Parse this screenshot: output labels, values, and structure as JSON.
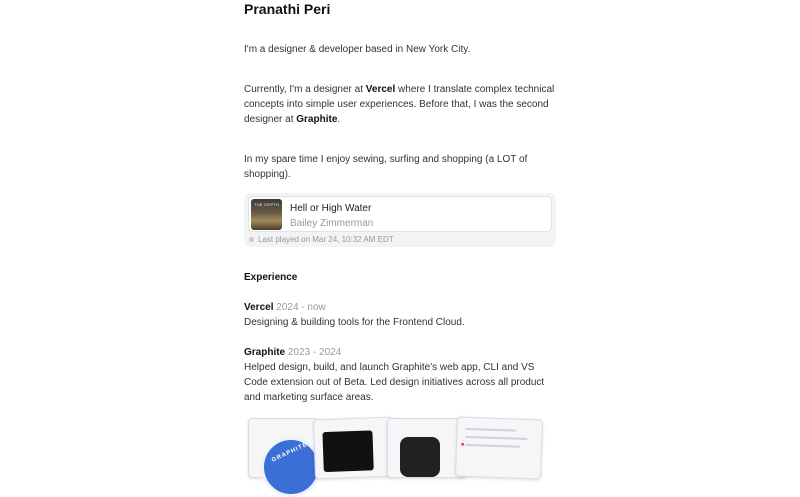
{
  "profile": {
    "name": "Pranathi Peri",
    "intro": "I'm a designer & developer based in New York City.",
    "current_pre": "Currently, I'm a designer at ",
    "current_company": "Vercel",
    "current_mid": " where I translate complex technical concepts into simple user experiences. Before that, I was the second designer at ",
    "previous_company": "Graphite",
    "current_end": ".",
    "hobbies": "In my spare time I enjoy sewing, surfing and shopping (a LOT of shopping)."
  },
  "now_playing": {
    "title": "Hell or High Water",
    "artist": "Bailey Zimmerman",
    "last_played": "Last played on Mar 24, 10:32 AM EDT",
    "cover_text": "THE DEPTH"
  },
  "experience": {
    "heading": "Experience",
    "jobs": [
      {
        "company": "Vercel",
        "years": "2024 - now",
        "description": "Designing & building tools for the Frontend Cloud."
      },
      {
        "company": "Graphite",
        "years": "2023 - 2024",
        "description": "Helped design, build, and launch Graphite's web app, CLI and VS Code extension out of Beta. Led design initiatives across all product and marketing surface areas."
      }
    ]
  },
  "showcase": {
    "badge_text": "GRAPHITE U"
  }
}
